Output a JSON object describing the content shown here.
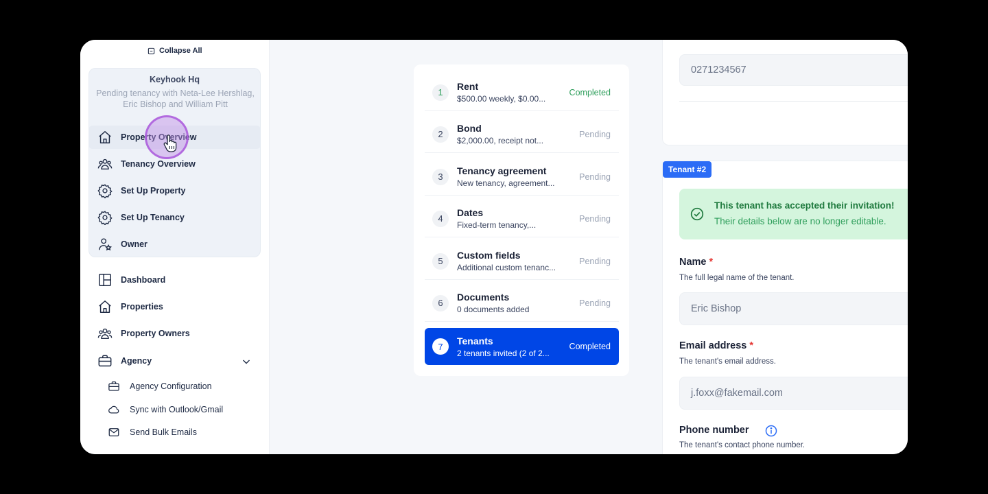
{
  "sidebar": {
    "collapse_label": "Collapse All",
    "property": {
      "name": "Keyhook Hq",
      "status": "Pending tenancy with Neta-Lee Hershlag, Eric Bishop and William Pitt"
    },
    "property_nav": [
      {
        "label": "Property Overview",
        "icon": "home-icon"
      },
      {
        "label": "Tenancy Overview",
        "icon": "users-icon"
      },
      {
        "label": "Set Up Property",
        "icon": "gear-icon"
      },
      {
        "label": "Set Up Tenancy",
        "icon": "gear-icon"
      },
      {
        "label": "Owner",
        "icon": "owner-icon"
      }
    ],
    "main_nav": [
      {
        "label": "Dashboard",
        "icon": "dashboard-icon"
      },
      {
        "label": "Properties",
        "icon": "home-icon"
      },
      {
        "label": "Property Owners",
        "icon": "users-icon"
      },
      {
        "label": "Agency",
        "icon": "briefcase-icon"
      }
    ],
    "agency_sub": [
      {
        "label": "Agency Configuration",
        "icon": "briefcase-icon"
      },
      {
        "label": "Sync with Outlook/Gmail",
        "icon": "cloud-icon"
      },
      {
        "label": "Send Bulk Emails",
        "icon": "mail-icon"
      }
    ]
  },
  "steps": [
    {
      "num": "1",
      "title": "Rent",
      "sub": "$500.00 weekly, $0.00...",
      "status": "Completed"
    },
    {
      "num": "2",
      "title": "Bond",
      "sub": "$2,000.00, receipt not...",
      "status": "Pending"
    },
    {
      "num": "3",
      "title": "Tenancy agreement",
      "sub": "New tenancy, agreement...",
      "status": "Pending"
    },
    {
      "num": "4",
      "title": "Dates",
      "sub": "Fixed-term tenancy,...",
      "status": "Pending"
    },
    {
      "num": "5",
      "title": "Custom fields",
      "sub": "Additional custom tenanc...",
      "status": "Pending"
    },
    {
      "num": "6",
      "title": "Documents",
      "sub": "0 documents added",
      "status": "Pending"
    },
    {
      "num": "7",
      "title": "Tenants",
      "sub": "2 tenants invited (2 of 2...",
      "status": "Completed"
    }
  ],
  "right": {
    "prev_phone_value": "0271234567",
    "tenant_badge": "Tenant #2",
    "accepted_title": "This tenant has accepted their invitation!",
    "accepted_sub": "Their details below are no longer editable.",
    "name_label": "Name",
    "name_help": "The full legal name of the tenant.",
    "name_value": "Eric Bishop",
    "email_label": "Email address",
    "email_help": "The tenant's email address.",
    "email_value": "j.foxx@fakemail.com",
    "phone_label": "Phone number",
    "phone_help": "The tenant's contact phone number.",
    "required_mark": "*"
  },
  "colors": {
    "accent": "#0046e6",
    "completed": "#2e9e5b",
    "badge": "#2b6cf6",
    "success_bg": "#d4f5dd"
  }
}
